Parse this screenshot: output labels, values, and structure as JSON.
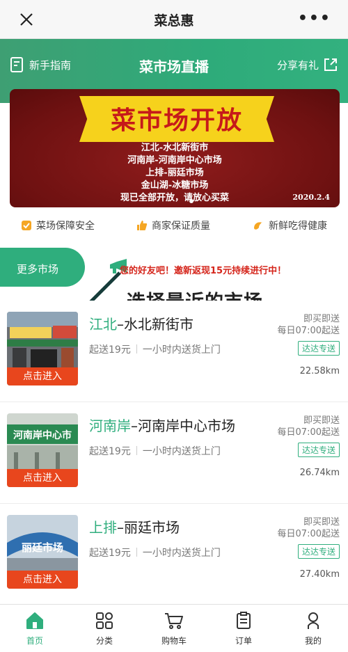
{
  "window": {
    "title": "菜总惠"
  },
  "header": {
    "guide_label": "新手指南",
    "title": "菜市场直播",
    "share_label": "分享有礼"
  },
  "banner": {
    "headline": "菜市场开放",
    "lines": [
      "江北-水北新街市",
      "河南岸-河南岸中心市场",
      "上排-丽廷市场",
      "金山湖-冰糖市场",
      "现已全部开放，请放心买菜"
    ],
    "date": "2020.2.4"
  },
  "guarantees": [
    {
      "icon": "shield-check-icon",
      "label": "菜场保障安全",
      "color": "#f5a623"
    },
    {
      "icon": "thumbs-up-icon",
      "label": "商家保证质量",
      "color": "#f5a623"
    },
    {
      "icon": "shrimp-icon",
      "label": "新鲜吃得健康",
      "color": "#f5a623"
    }
  ],
  "section": {
    "more_markets_label": "更多市场",
    "promo_text": "您的好友吧！邀新返现15元持续进行中！"
  },
  "annotation": {
    "text": "选择最近的市场"
  },
  "markets": [
    {
      "region": "江北",
      "name": "水北新街市",
      "dash": "–",
      "min_order": "起送19元",
      "delivery": "一小时内送货上门",
      "buy_now": "即买即送",
      "daily": "每日07:00起送",
      "badge": "达达专送",
      "distance": "22.58km",
      "enter_label": "点击进入",
      "sign_text": ""
    },
    {
      "region": "河南岸",
      "name": "河南岸中心市场",
      "dash": "–",
      "min_order": "起送19元",
      "delivery": "一小时内送货上门",
      "buy_now": "即买即送",
      "daily": "每日07:00起送",
      "badge": "达达专送",
      "distance": "26.74km",
      "enter_label": "点击进入",
      "sign_text": "河南岸中心市"
    },
    {
      "region": "上排",
      "name": "丽廷市场",
      "dash": "–",
      "min_order": "起送19元",
      "delivery": "一小时内送货上门",
      "buy_now": "即买即送",
      "daily": "每日07:00起送",
      "badge": "达达专送",
      "distance": "27.40km",
      "enter_label": "点击进入",
      "sign_text": "丽廷市场"
    }
  ],
  "tabbar": [
    {
      "icon": "home-icon",
      "label": "首页",
      "active": true
    },
    {
      "icon": "grid-icon",
      "label": "分类",
      "active": false
    },
    {
      "icon": "cart-icon",
      "label": "购物车",
      "active": false
    },
    {
      "icon": "order-icon",
      "label": "订单",
      "active": false
    },
    {
      "icon": "user-icon",
      "label": "我的",
      "active": false
    }
  ],
  "colors": {
    "accent": "#2fae7d",
    "promo": "#d5251b",
    "enter_button": "#e8461d",
    "banner_bg": "#7a1414",
    "ribbon": "#f6d21c"
  }
}
